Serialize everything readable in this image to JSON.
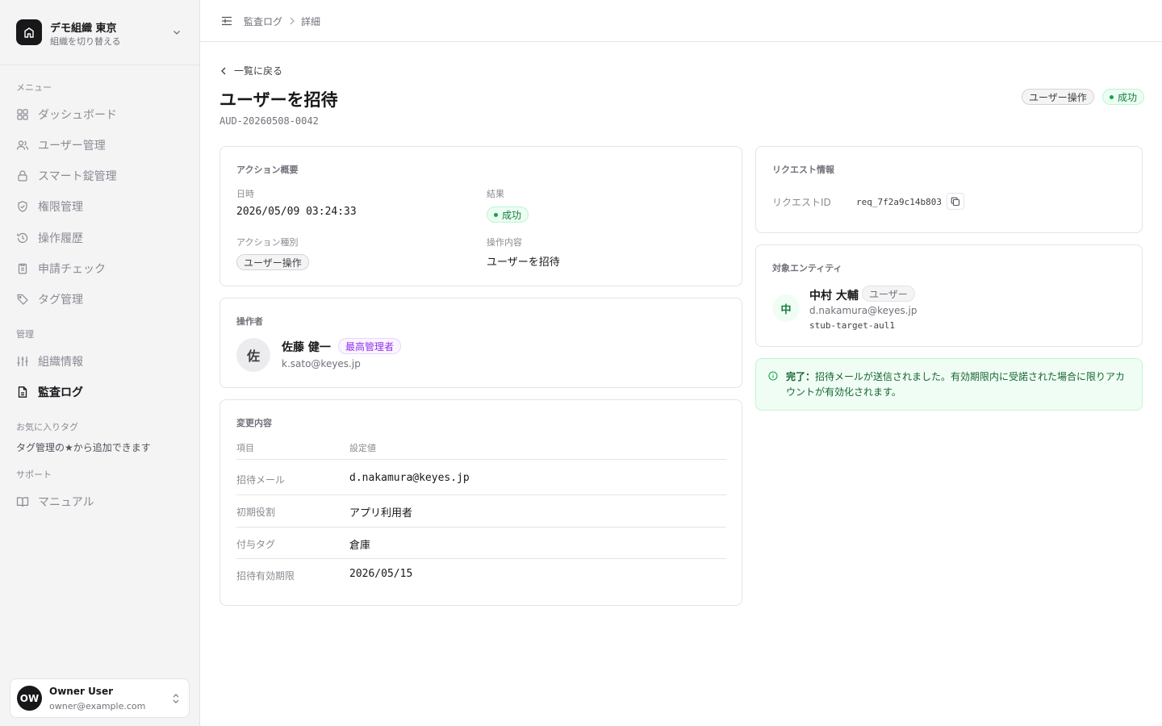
{
  "sidebar": {
    "org_name": "デモ組織 東京",
    "org_sub": "組織を切り替える",
    "section_menu": "メニュー",
    "items": [
      {
        "label": "ダッシュボード",
        "icon": "grid-icon"
      },
      {
        "label": "ユーザー管理",
        "icon": "users-icon"
      },
      {
        "label": "スマート錠管理",
        "icon": "lock-icon"
      },
      {
        "label": "権限管理",
        "icon": "shield-icon"
      },
      {
        "label": "操作履歴",
        "icon": "history-icon"
      },
      {
        "label": "申請チェック",
        "icon": "clipboard-icon"
      },
      {
        "label": "タグ管理",
        "icon": "tag-icon"
      }
    ],
    "section_admin": "管理",
    "admin_items": [
      {
        "label": "組織情報",
        "icon": "sliders-icon"
      },
      {
        "label": "監査ログ",
        "icon": "file-icon",
        "active": true
      }
    ],
    "section_fav": "お気に入りタグ",
    "fav_hint": "タグ管理の★から追加できます",
    "section_support": "サポート",
    "support_items": [
      {
        "label": "マニュアル",
        "icon": "book-icon"
      }
    ],
    "user": {
      "initials": "OW",
      "name": "Owner User",
      "email": "owner@example.com"
    }
  },
  "breadcrumb": [
    "監査ログ",
    "詳細"
  ],
  "header": {
    "back_label": "一覧に戻る",
    "title": "ユーザーを招待",
    "id": "AUD-20260508-0042",
    "type_badge": "ユーザー操作",
    "status_badge": "成功"
  },
  "summary": {
    "title": "アクション概要",
    "datetime_label": "日時",
    "datetime": "2026/05/09 03:24:33",
    "result_label": "結果",
    "result": "成功",
    "action_type_label": "アクション種別",
    "action_type": "ユーザー操作",
    "operation_label": "操作内容",
    "operation": "ユーザーを招待"
  },
  "operator": {
    "title": "操作者",
    "initial": "佐",
    "name": "佐藤 健一",
    "role": "最高管理者",
    "email": "k.sato@keyes.jp"
  },
  "changes": {
    "title": "変更内容",
    "columns": [
      "項目",
      "設定値"
    ],
    "rows": [
      {
        "key": "招待メール",
        "value": "d.nakamura@keyes.jp"
      },
      {
        "key": "初期役割",
        "value": "アプリ利用者"
      },
      {
        "key": "付与タグ",
        "value": "倉庫"
      },
      {
        "key": "招待有効期限",
        "value": "2026/05/15"
      }
    ]
  },
  "request": {
    "title": "リクエスト情報",
    "id_label": "リクエストID",
    "id": "req_7f2a9c14b803"
  },
  "target": {
    "title": "対象エンティティ",
    "initial": "中",
    "name": "中村 大輔",
    "type": "ユーザー",
    "email": "d.nakamura@keyes.jp",
    "id": "stub-target-aul1"
  },
  "alert": {
    "prefix": "完了：",
    "text": "招待メールが送信されました。有効期限内に受諾された場合に限りアカウントが有効化されます。"
  },
  "colors": {
    "success": "#16a34a",
    "admin_purple": "#9333ea",
    "sidebar_bg": "#f4f4f5"
  }
}
